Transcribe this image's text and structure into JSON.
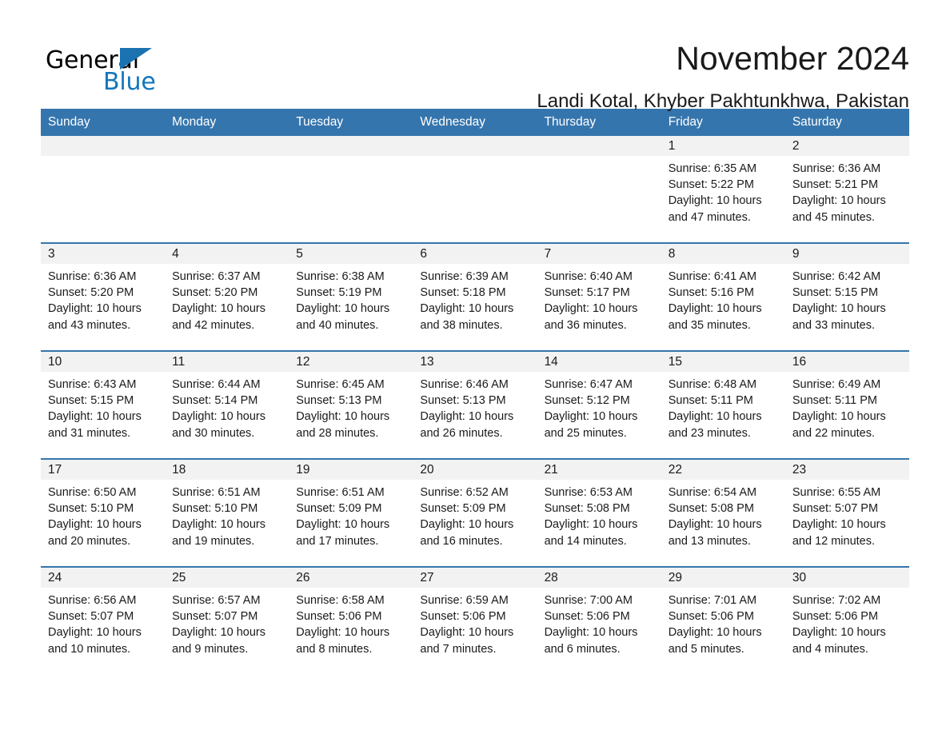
{
  "brand": {
    "word1": "General",
    "word2": "Blue",
    "flag_icon": "triangle-flag-icon",
    "accent_color": "#1176bc"
  },
  "header": {
    "month_title": "November 2024",
    "location": "Landi Kotal, Khyber Pakhtunkhwa, Pakistan",
    "header_bg": "#3575ad",
    "daystrip_bg": "#f2f2f2"
  },
  "weekday_headers": [
    "Sunday",
    "Monday",
    "Tuesday",
    "Wednesday",
    "Thursday",
    "Friday",
    "Saturday"
  ],
  "weeks": [
    [
      {
        "day": "",
        "lines": []
      },
      {
        "day": "",
        "lines": []
      },
      {
        "day": "",
        "lines": []
      },
      {
        "day": "",
        "lines": []
      },
      {
        "day": "",
        "lines": []
      },
      {
        "day": "1",
        "lines": [
          "Sunrise: 6:35 AM",
          "Sunset: 5:22 PM",
          "Daylight: 10 hours",
          "and 47 minutes."
        ]
      },
      {
        "day": "2",
        "lines": [
          "Sunrise: 6:36 AM",
          "Sunset: 5:21 PM",
          "Daylight: 10 hours",
          "and 45 minutes."
        ]
      }
    ],
    [
      {
        "day": "3",
        "lines": [
          "Sunrise: 6:36 AM",
          "Sunset: 5:20 PM",
          "Daylight: 10 hours",
          "and 43 minutes."
        ]
      },
      {
        "day": "4",
        "lines": [
          "Sunrise: 6:37 AM",
          "Sunset: 5:20 PM",
          "Daylight: 10 hours",
          "and 42 minutes."
        ]
      },
      {
        "day": "5",
        "lines": [
          "Sunrise: 6:38 AM",
          "Sunset: 5:19 PM",
          "Daylight: 10 hours",
          "and 40 minutes."
        ]
      },
      {
        "day": "6",
        "lines": [
          "Sunrise: 6:39 AM",
          "Sunset: 5:18 PM",
          "Daylight: 10 hours",
          "and 38 minutes."
        ]
      },
      {
        "day": "7",
        "lines": [
          "Sunrise: 6:40 AM",
          "Sunset: 5:17 PM",
          "Daylight: 10 hours",
          "and 36 minutes."
        ]
      },
      {
        "day": "8",
        "lines": [
          "Sunrise: 6:41 AM",
          "Sunset: 5:16 PM",
          "Daylight: 10 hours",
          "and 35 minutes."
        ]
      },
      {
        "day": "9",
        "lines": [
          "Sunrise: 6:42 AM",
          "Sunset: 5:15 PM",
          "Daylight: 10 hours",
          "and 33 minutes."
        ]
      }
    ],
    [
      {
        "day": "10",
        "lines": [
          "Sunrise: 6:43 AM",
          "Sunset: 5:15 PM",
          "Daylight: 10 hours",
          "and 31 minutes."
        ]
      },
      {
        "day": "11",
        "lines": [
          "Sunrise: 6:44 AM",
          "Sunset: 5:14 PM",
          "Daylight: 10 hours",
          "and 30 minutes."
        ]
      },
      {
        "day": "12",
        "lines": [
          "Sunrise: 6:45 AM",
          "Sunset: 5:13 PM",
          "Daylight: 10 hours",
          "and 28 minutes."
        ]
      },
      {
        "day": "13",
        "lines": [
          "Sunrise: 6:46 AM",
          "Sunset: 5:13 PM",
          "Daylight: 10 hours",
          "and 26 minutes."
        ]
      },
      {
        "day": "14",
        "lines": [
          "Sunrise: 6:47 AM",
          "Sunset: 5:12 PM",
          "Daylight: 10 hours",
          "and 25 minutes."
        ]
      },
      {
        "day": "15",
        "lines": [
          "Sunrise: 6:48 AM",
          "Sunset: 5:11 PM",
          "Daylight: 10 hours",
          "and 23 minutes."
        ]
      },
      {
        "day": "16",
        "lines": [
          "Sunrise: 6:49 AM",
          "Sunset: 5:11 PM",
          "Daylight: 10 hours",
          "and 22 minutes."
        ]
      }
    ],
    [
      {
        "day": "17",
        "lines": [
          "Sunrise: 6:50 AM",
          "Sunset: 5:10 PM",
          "Daylight: 10 hours",
          "and 20 minutes."
        ]
      },
      {
        "day": "18",
        "lines": [
          "Sunrise: 6:51 AM",
          "Sunset: 5:10 PM",
          "Daylight: 10 hours",
          "and 19 minutes."
        ]
      },
      {
        "day": "19",
        "lines": [
          "Sunrise: 6:51 AM",
          "Sunset: 5:09 PM",
          "Daylight: 10 hours",
          "and 17 minutes."
        ]
      },
      {
        "day": "20",
        "lines": [
          "Sunrise: 6:52 AM",
          "Sunset: 5:09 PM",
          "Daylight: 10 hours",
          "and 16 minutes."
        ]
      },
      {
        "day": "21",
        "lines": [
          "Sunrise: 6:53 AM",
          "Sunset: 5:08 PM",
          "Daylight: 10 hours",
          "and 14 minutes."
        ]
      },
      {
        "day": "22",
        "lines": [
          "Sunrise: 6:54 AM",
          "Sunset: 5:08 PM",
          "Daylight: 10 hours",
          "and 13 minutes."
        ]
      },
      {
        "day": "23",
        "lines": [
          "Sunrise: 6:55 AM",
          "Sunset: 5:07 PM",
          "Daylight: 10 hours",
          "and 12 minutes."
        ]
      }
    ],
    [
      {
        "day": "24",
        "lines": [
          "Sunrise: 6:56 AM",
          "Sunset: 5:07 PM",
          "Daylight: 10 hours",
          "and 10 minutes."
        ]
      },
      {
        "day": "25",
        "lines": [
          "Sunrise: 6:57 AM",
          "Sunset: 5:07 PM",
          "Daylight: 10 hours",
          "and 9 minutes."
        ]
      },
      {
        "day": "26",
        "lines": [
          "Sunrise: 6:58 AM",
          "Sunset: 5:06 PM",
          "Daylight: 10 hours",
          "and 8 minutes."
        ]
      },
      {
        "day": "27",
        "lines": [
          "Sunrise: 6:59 AM",
          "Sunset: 5:06 PM",
          "Daylight: 10 hours",
          "and 7 minutes."
        ]
      },
      {
        "day": "28",
        "lines": [
          "Sunrise: 7:00 AM",
          "Sunset: 5:06 PM",
          "Daylight: 10 hours",
          "and 6 minutes."
        ]
      },
      {
        "day": "29",
        "lines": [
          "Sunrise: 7:01 AM",
          "Sunset: 5:06 PM",
          "Daylight: 10 hours",
          "and 5 minutes."
        ]
      },
      {
        "day": "30",
        "lines": [
          "Sunrise: 7:02 AM",
          "Sunset: 5:06 PM",
          "Daylight: 10 hours",
          "and 4 minutes."
        ]
      }
    ]
  ]
}
